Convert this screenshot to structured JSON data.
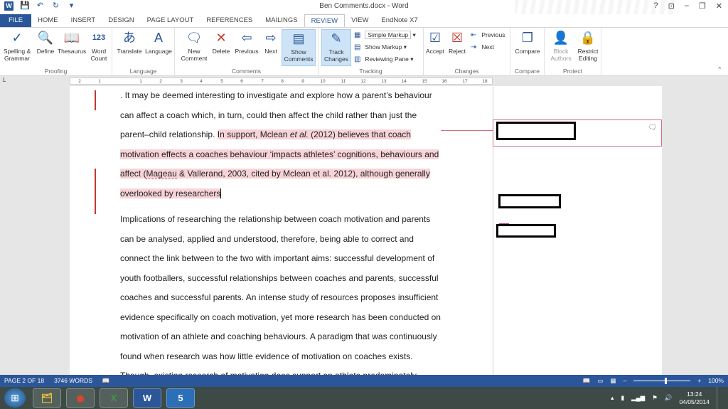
{
  "window": {
    "title": "Ben Comments.docx - Word",
    "controls": [
      "?",
      "⊡",
      "–",
      "❐",
      "✕"
    ]
  },
  "qat": [
    "W",
    "💾",
    "↶",
    "↻",
    "▾"
  ],
  "tabs": [
    "FILE",
    "HOME",
    "INSERT",
    "DESIGN",
    "PAGE LAYOUT",
    "REFERENCES",
    "MAILINGS",
    "REVIEW",
    "VIEW",
    "EndNote X7"
  ],
  "active_tab": "REVIEW",
  "ribbon": {
    "proofing": {
      "name": "Proofing",
      "spelling": [
        "Spelling &",
        "Grammar"
      ],
      "define": "Define",
      "thesaurus": "Thesaurus",
      "wordcount": [
        "Word",
        "Count"
      ]
    },
    "language": {
      "name": "Language",
      "translate": "Translate",
      "language": "Language"
    },
    "comments": {
      "name": "Comments",
      "new": [
        "New",
        "Comment"
      ],
      "delete": "Delete",
      "previous": "Previous",
      "next": "Next",
      "show": [
        "Show",
        "Comments"
      ]
    },
    "tracking": {
      "name": "Tracking",
      "track": [
        "Track",
        "Changes"
      ],
      "markup": "Simple Markup",
      "show_markup": "Show Markup",
      "reviewing_pane": "Reviewing Pane"
    },
    "changes": {
      "name": "Changes",
      "accept": "Accept",
      "reject": "Reject",
      "previous": "Previous",
      "next": "Next"
    },
    "compare": {
      "name": "Compare",
      "compare": "Compare"
    },
    "protect": {
      "name": "Protect",
      "block": [
        "Block",
        "Authors"
      ],
      "restrict": [
        "Restrict",
        "Editing"
      ]
    }
  },
  "ruler": {
    "tab_selector": "L",
    "marks": [
      "2",
      "1",
      "1",
      "2",
      "3",
      "4",
      "5",
      "6",
      "7",
      "8",
      "9",
      "10",
      "11",
      "12",
      "13",
      "14",
      "15",
      "16",
      "17",
      "18"
    ]
  },
  "document": {
    "p1": [
      ". It may be deemed interesting to investigate and explore how a parent’s behaviour",
      "can affect a coach which, in turn, could then affect the child rather than just the"
    ],
    "p1_l3a": "parent–child relationship. ",
    "p1_l3b": "In support, Mclean ",
    "p1_l3c": "et al.",
    "p1_l3d": " (2012) believes that coach",
    "p1_l4": "motivation effects a coaches behaviour ‘impacts athletes’ cognitions, behaviours and",
    "p1_l5a": "affect (",
    "p1_l5b": "Mageau",
    "p1_l5c": " & Vallerand, 2003, cited by Mclean et al. 2012), although generally",
    "p1_l6": "overlooked by researchers",
    "p2": [
      "Implications of researching the relationship between coach motivation and parents",
      "can be analysed, applied and understood, therefore, being able to correct and",
      "connect the link between to the two with important aims: successful development of",
      "youth footballers, successful relationships between coaches and parents, successful",
      "coaches and successful parents. An intense study of resources proposes insufficient",
      "evidence specifically on coach motivation, yet more research has been conducted on",
      "motivation of an athlete and coaching behaviours. A paradigm that was continuously",
      "found when research was how little evidence of motivation on coaches exists.",
      "Though, existing research of motivation does support an athlete predominately"
    ]
  },
  "status": {
    "page": "PAGE 2 OF 18",
    "words": "3746 WORDS",
    "zoom": "100%",
    "zoom_level": 1.0
  },
  "taskbar": {
    "apps": [
      "folder",
      "chrome",
      "excel",
      "word",
      "app-5"
    ],
    "labels": [
      "🗂",
      "◉",
      "X",
      "W",
      "5"
    ],
    "time": "13:24",
    "date": "04/05/2014"
  },
  "colors": {
    "word_blue": "#2b579a",
    "change_bar": "#c0392b",
    "highlight": "#f7d3d8"
  }
}
